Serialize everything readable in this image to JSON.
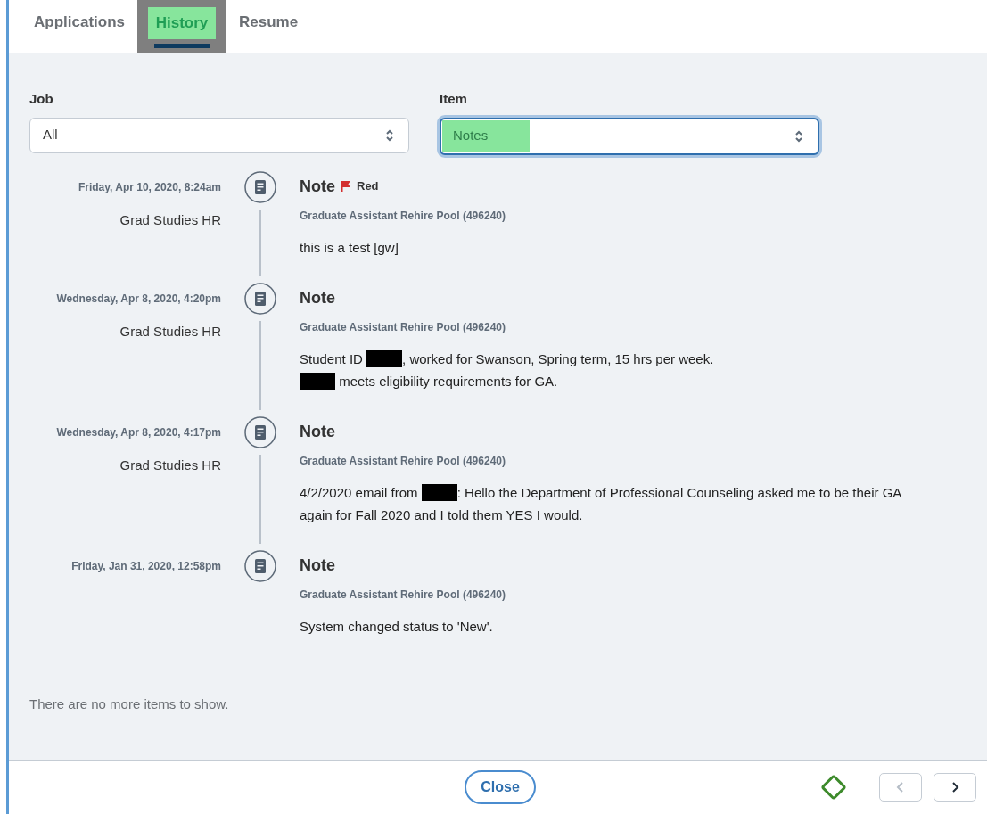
{
  "tabs": [
    {
      "label": "Applications",
      "selected": false
    },
    {
      "label": "History",
      "selected": true
    },
    {
      "label": "Resume",
      "selected": false
    }
  ],
  "filters": [
    {
      "label": "Job",
      "value": "All",
      "focused": false
    },
    {
      "label": "Item",
      "value": "Notes",
      "focused": true
    }
  ],
  "entries": [
    {
      "date": "Friday, Apr 10, 2020, 8:24am",
      "author": "Grad Studies HR",
      "title": "Note",
      "flag": {
        "label": "Red",
        "color": "#d32f2f"
      },
      "job": "Graduate Assistant Rehire Pool (496240)",
      "body": [
        [
          {
            "kind": "text",
            "text": "this is a test [gw]"
          }
        ]
      ]
    },
    {
      "date": "Wednesday, Apr 8, 2020, 4:20pm",
      "author": "Grad Studies HR",
      "title": "Note",
      "job": "Graduate Assistant Rehire Pool (496240)",
      "body": [
        [
          {
            "kind": "text",
            "text": "Student ID "
          },
          {
            "kind": "redacted"
          },
          {
            "kind": "text",
            "text": ", worked for Swanson, Spring term, 15 hrs per week."
          }
        ],
        [
          {
            "kind": "redacted"
          },
          {
            "kind": "text",
            "text": " meets eligibility requirements for GA."
          }
        ]
      ]
    },
    {
      "date": "Wednesday, Apr 8, 2020, 4:17pm",
      "author": "Grad Studies HR",
      "title": "Note",
      "job": "Graduate Assistant Rehire Pool (496240)",
      "body": [
        [
          {
            "kind": "text",
            "text": "4/2/2020 email from "
          },
          {
            "kind": "redacted"
          },
          {
            "kind": "text",
            "text": ": Hello the Department of Professional Counseling asked me to be their GA"
          }
        ],
        [
          {
            "kind": "text",
            "text": "again for Fall 2020 and I told them YES I would."
          }
        ]
      ]
    },
    {
      "date": "Friday, Jan 31, 2020, 12:58pm",
      "title": "Note",
      "job": "Graduate Assistant Rehire Pool (496240)",
      "body": [
        [
          {
            "kind": "text",
            "text": "System changed status to 'New'."
          }
        ]
      ]
    }
  ],
  "end_message": "There are no more items to show.",
  "footer": {
    "close": "Close",
    "prev_disabled": true,
    "next_disabled": false
  }
}
